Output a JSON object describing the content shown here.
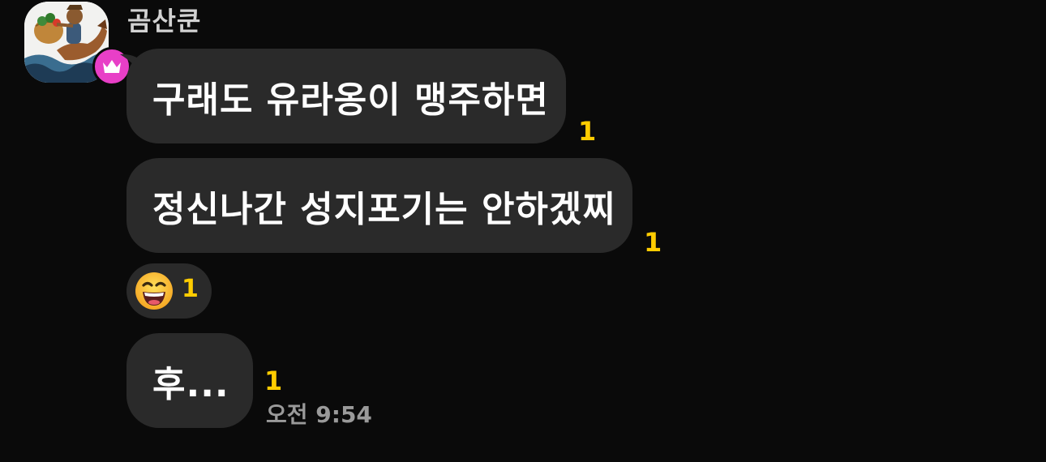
{
  "chat": {
    "sender": {
      "name": "곰산쿤",
      "avatar_icon": "illustrated-bear-rider-avatar",
      "badge_icon": "crown-icon",
      "badge_color": "#e83fc7"
    },
    "messages": [
      {
        "text": "구래도 유라옹이 맹주하면",
        "unread": "1"
      },
      {
        "text": "정신나간 성지포기는 안하겠찌",
        "unread": "1"
      },
      {
        "text": "후...",
        "unread": "1"
      }
    ],
    "reaction": {
      "emoji_icon": "grinning-squinting-face-emoji",
      "count": "1"
    },
    "timestamp": "오전 9:54",
    "colors": {
      "background": "#0a0a0a",
      "bubble": "#2a2a2a",
      "unread": "#ffcc00"
    }
  }
}
